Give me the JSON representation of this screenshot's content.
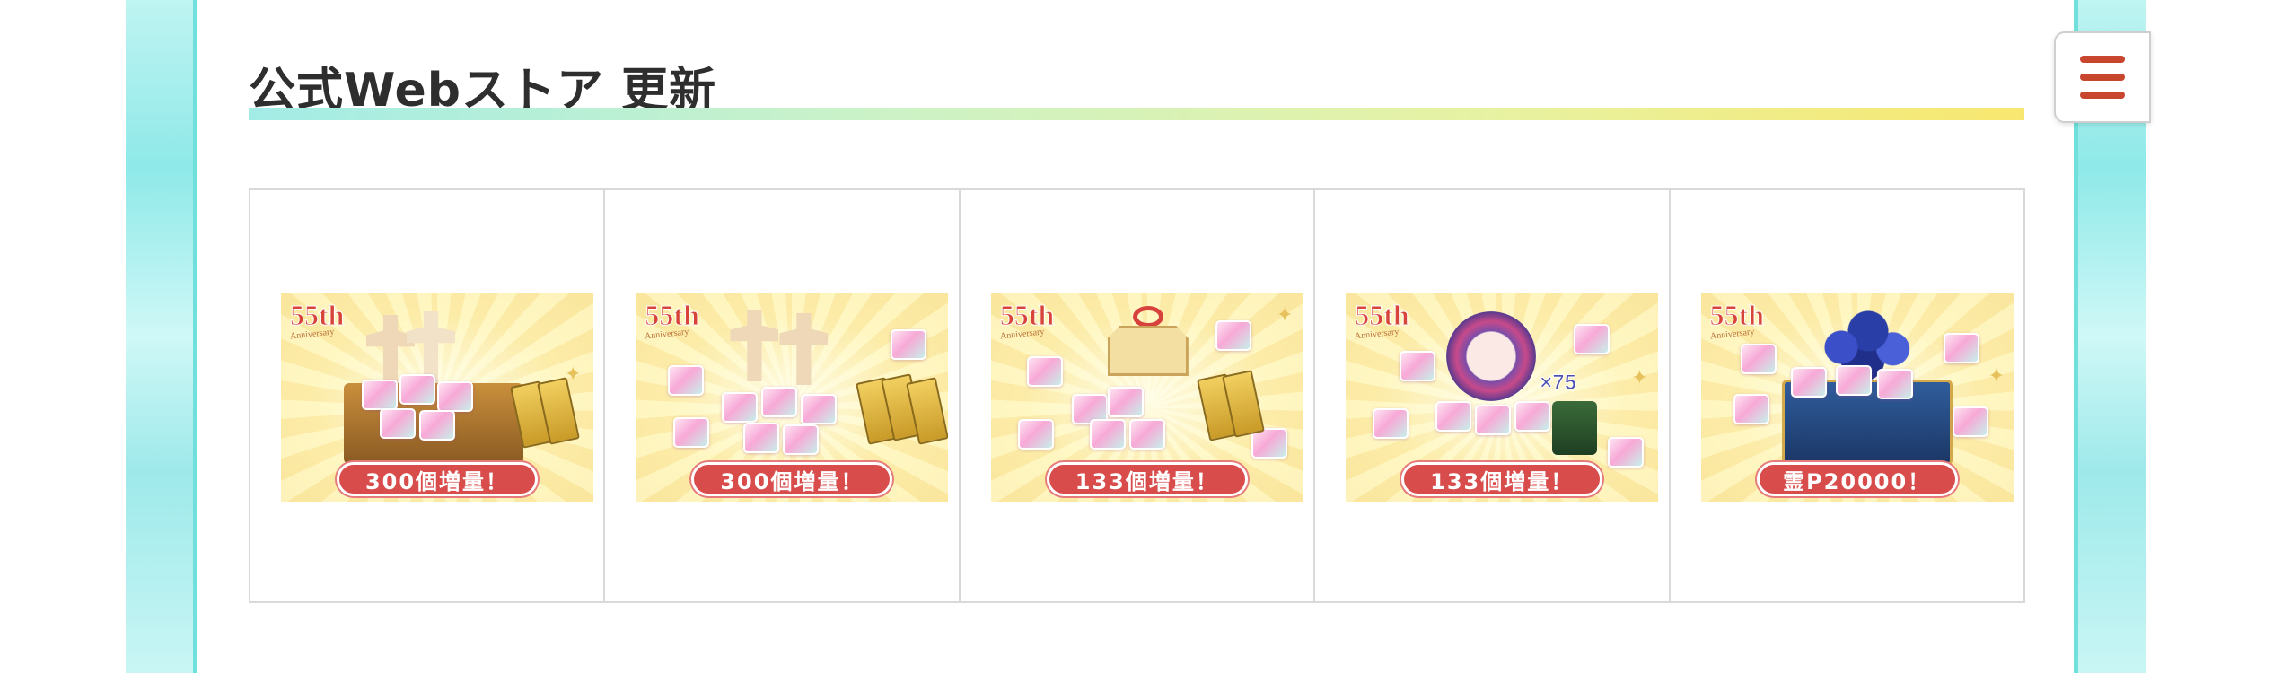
{
  "section": {
    "title": "公式Webストア 更新"
  },
  "menu": {
    "icon": "hamburger-menu-icon"
  },
  "banners": [
    {
      "badge": "55th",
      "badge_sub": "Anniversary",
      "label": "300個増量！"
    },
    {
      "badge": "55th",
      "badge_sub": "Anniversary",
      "label": "300個増量！"
    },
    {
      "badge": "55th",
      "badge_sub": "Anniversary",
      "label": "133個増量！"
    },
    {
      "badge": "55th",
      "badge_sub": "Anniversary",
      "label": "133個増量！",
      "multiplier": "×75"
    },
    {
      "badge": "55th",
      "badge_sub": "Anniversary",
      "label": "霊P20000！"
    }
  ],
  "colors": {
    "accent_red": "#d94c4c",
    "frame_teal": "#8ee9e8",
    "menu_icon": "#c8452e"
  }
}
